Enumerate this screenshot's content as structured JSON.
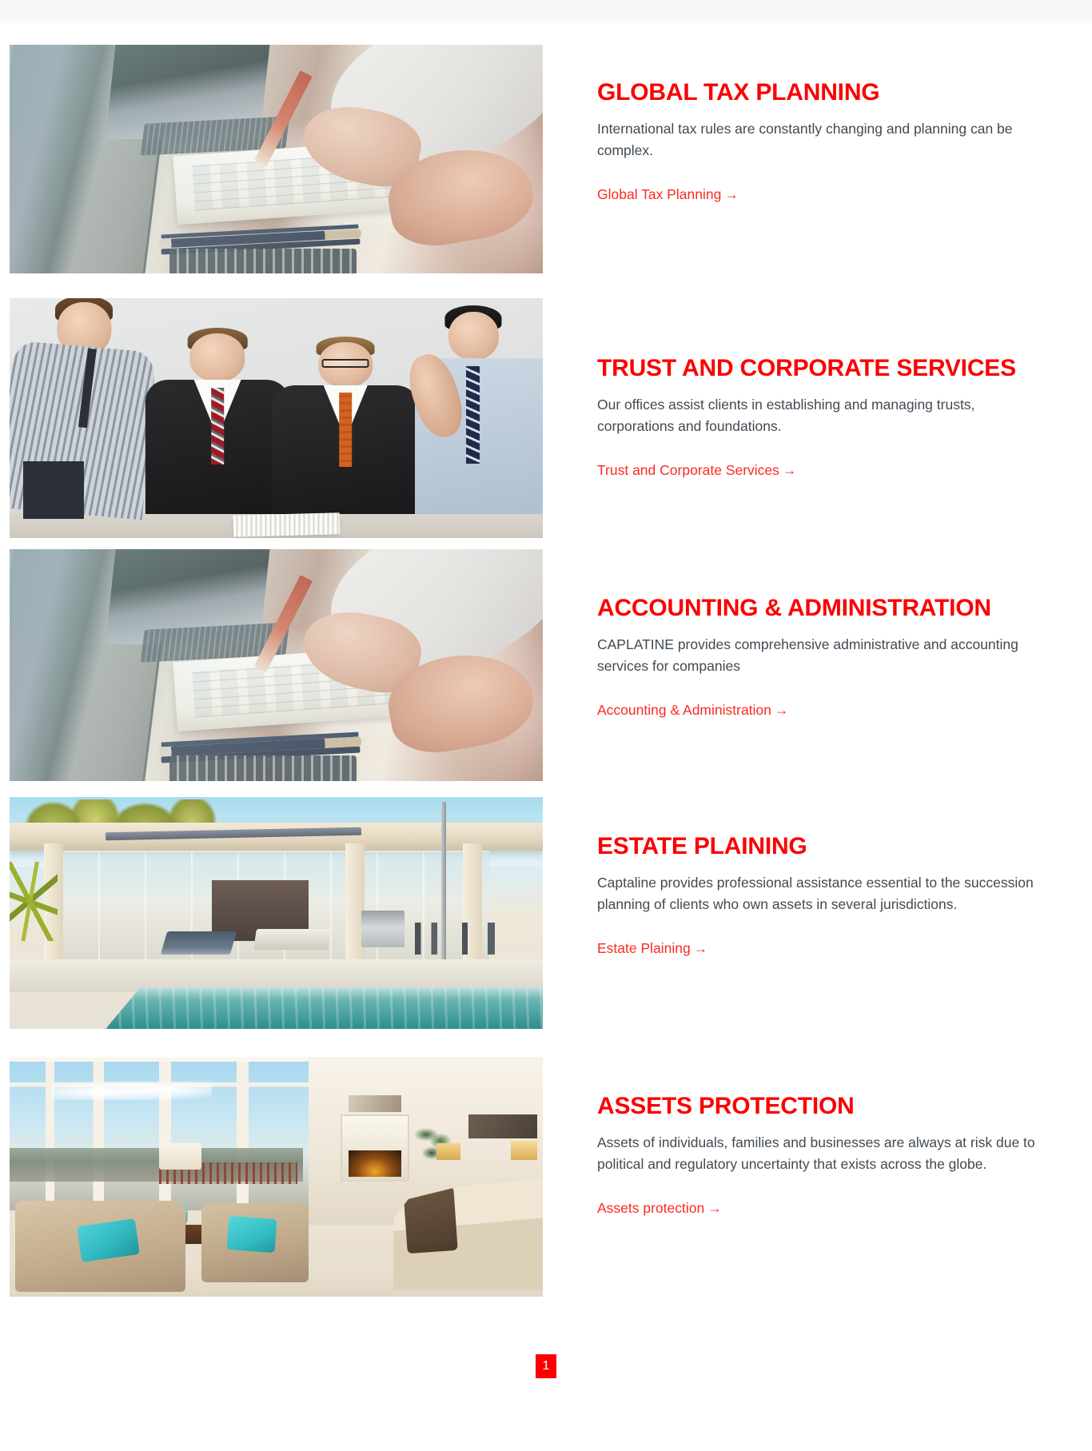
{
  "page": {
    "background_color": "#ffffff",
    "topbar_color": "#f7f8fa",
    "accent_color": "#fb0000",
    "link_color": "#fb2a22",
    "body_text_color": "#414a52"
  },
  "services": [
    {
      "id": "global-tax-planning",
      "title": "GLOBAL TAX PLANNING",
      "description": "International tax rules are constantly changing and planning can be complex.",
      "link_label": "Global Tax Planning",
      "link_arrow": "→",
      "image_alt": "Hands writing on a notepad beside two laptops on a wooden desk"
    },
    {
      "id": "trust-and-corporate-services",
      "title": "TRUST AND CORPORATE SERVICES",
      "description": "Our offices assist clients in establishing and managing trusts, corporations and foundations.",
      "link_label": "Trust and Corporate Services",
      "link_arrow": "→",
      "image_alt": "Four businessmen in suits reviewing a document at a table"
    },
    {
      "id": "accounting-and-administration",
      "title": "ACCOUNTING & ADMINISTRATION",
      "description": "CAPLATINE provides comprehensive administrative and accounting services for companies",
      "link_label": "Accounting & Administration",
      "link_arrow": "→",
      "image_alt": "Hands writing on a notepad beside two laptops on a wooden desk"
    },
    {
      "id": "estate-plaining",
      "title": "ESTATE PLAINING",
      "description": "Captaline provides professional assistance essential to the succession planning of clients who own assets in several jurisdictions.",
      "link_label": "Estate Plaining",
      "link_arrow": "→",
      "image_alt": "Modern luxury house exterior with swimming pool and patio furniture"
    },
    {
      "id": "assets-protection",
      "title": "ASSETS PROTECTION",
      "description": "Assets of individuals, families and businesses are always at risk due to political and regulatory uncertainty that exists across the globe.",
      "link_label": "Assets protection",
      "link_arrow": "→",
      "image_alt": "Bright living room interior with armchairs, teal cushions and a fireplace"
    }
  ],
  "pagination": {
    "current_page": "1"
  }
}
